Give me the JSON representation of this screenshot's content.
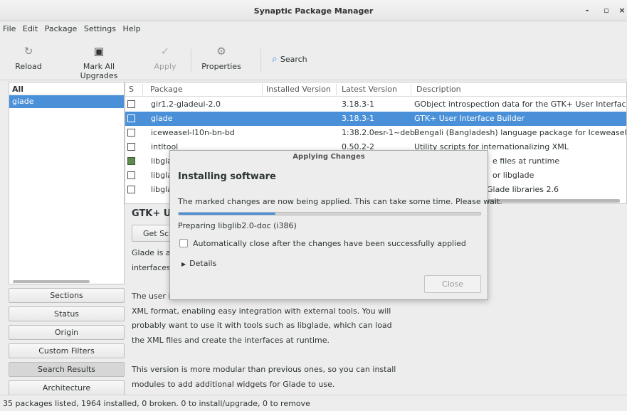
{
  "window": {
    "title": "Synaptic Package Manager",
    "minimize": "-",
    "maximize": "▫",
    "close": "×"
  },
  "menu": [
    "File",
    "Edit",
    "Package",
    "Settings",
    "Help"
  ],
  "toolbar": {
    "reload": "Reload",
    "mark_all": "Mark All Upgrades",
    "apply": "Apply",
    "properties": "Properties",
    "search": "Search"
  },
  "filters": {
    "header": "All",
    "selected": "glade",
    "buttons": [
      "Sections",
      "Status",
      "Origin",
      "Custom Filters",
      "Search Results",
      "Architecture"
    ]
  },
  "table": {
    "headers": {
      "s": "S",
      "package": "Package",
      "installed": "Installed Version",
      "latest": "Latest Version",
      "description": "Description"
    },
    "rows": [
      {
        "package": "gir1.2-gladeui-2.0",
        "installed": "",
        "latest": "3.18.3-1",
        "description": "GObject introspection data for the GTK+ User Interface B"
      },
      {
        "package": "glade",
        "installed": "",
        "latest": "3.18.3-1",
        "description": "GTK+ User Interface Builder"
      },
      {
        "package": "iceweasel-l10n-bn-bd",
        "installed": "",
        "latest": "1:38.2.0esr-1~deb",
        "description": "Bengali (Bangladesh) language package for Iceweasel"
      },
      {
        "package": "intltool",
        "installed": "",
        "latest": "0.50.2-2",
        "description": "Utility scripts for internationalizing XML"
      },
      {
        "package": "libgla",
        "installed": "",
        "latest": "",
        "description": "e files at runtime"
      },
      {
        "package": "libgla",
        "installed": "",
        "latest": "",
        "description": "or libglade"
      },
      {
        "package": "libgla",
        "installed": "",
        "latest": "",
        "description": "Glade libraries 2.6"
      }
    ]
  },
  "details": {
    "title": "GTK+ Us",
    "get_button": "Get Scr",
    "lines": [
      "Glade is a",
      "interfaces",
      "The user i",
      "XML format, enabling easy integration with external tools. You will",
      "probably want to use it with tools such as libglade, which can load",
      "the XML files and create the interfaces at runtime.",
      "This version is more modular than previous ones, so you can install",
      "modules to add additional widgets for Glade to use."
    ]
  },
  "status": "35 packages listed, 1964 installed, 0 broken. 0 to install/upgrade, 0 to remove",
  "dialog": {
    "title": "Applying Changes",
    "heading": "Installing software",
    "message": "The marked changes are now being applied. This can take some time. Please wait.",
    "progress": 0.32,
    "current": "Preparing libglib2.0-doc (i386)",
    "auto_close": "Automatically close after the changes have been successfully applied",
    "details": "Details",
    "close": "Close"
  },
  "colors": {
    "accent": "#4a90d9",
    "installed": "#5e8a4e"
  }
}
